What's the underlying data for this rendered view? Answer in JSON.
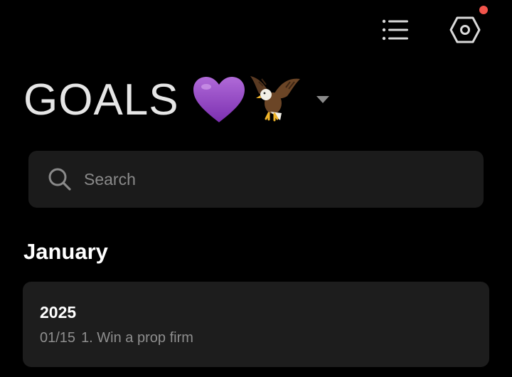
{
  "header": {
    "title": "GOALS",
    "title_emojis": [
      "💜",
      "🦅"
    ],
    "menu_icon": "list-icon",
    "settings_icon": "hexagon-settings-icon",
    "notification_dot_color": "#f2544b"
  },
  "search": {
    "placeholder": "Search",
    "value": ""
  },
  "sections": [
    {
      "heading": "January",
      "notes": [
        {
          "title": "2025",
          "date": "01/15",
          "preview": "1. Win a prop firm"
        }
      ]
    }
  ],
  "colors": {
    "background": "#000000",
    "card": "#1d1d1d",
    "search_bg": "#1b1b1b",
    "muted_text": "#8e8e8e"
  }
}
